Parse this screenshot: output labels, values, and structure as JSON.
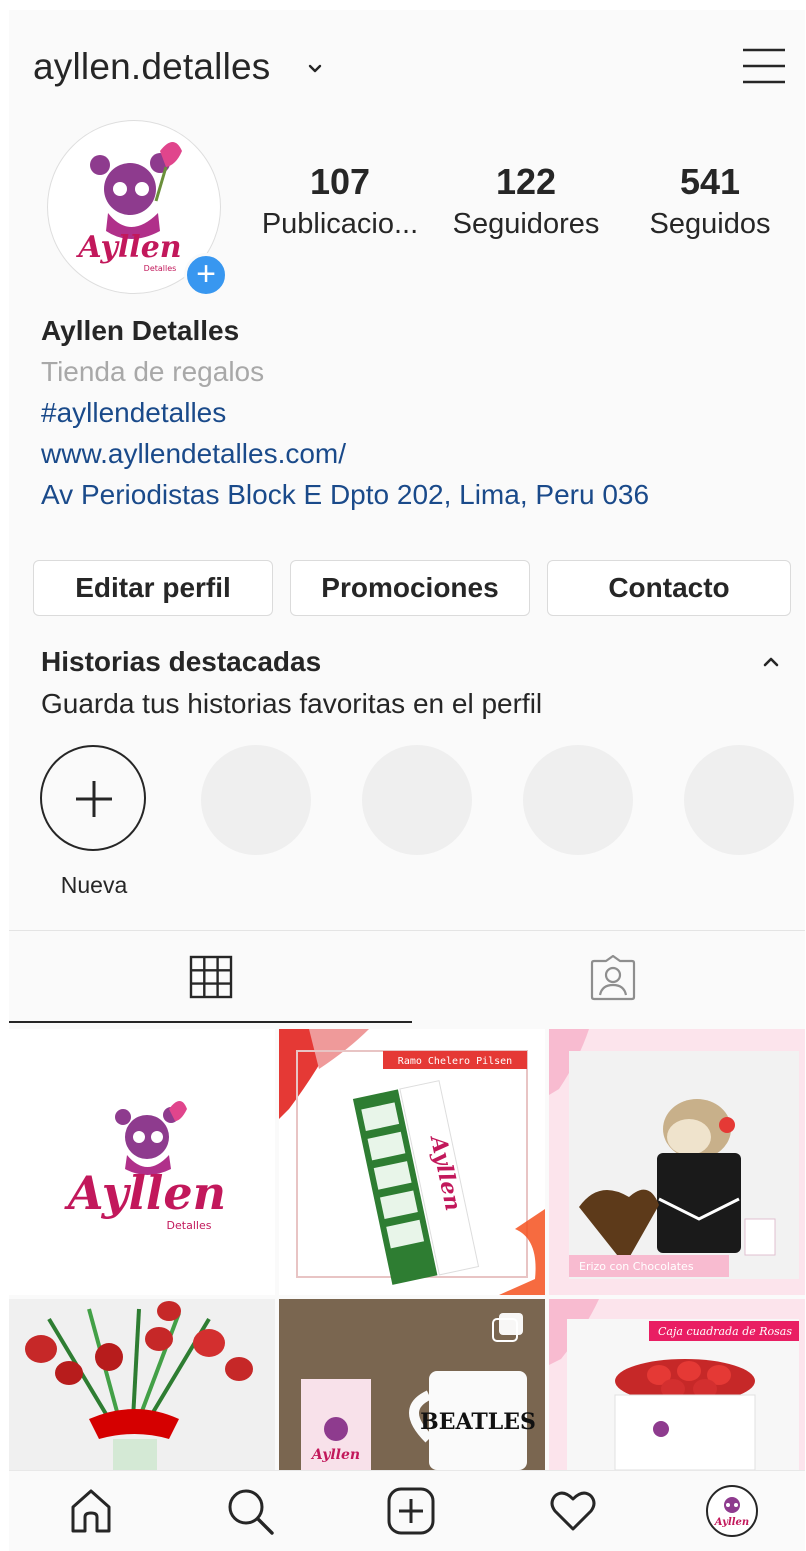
{
  "header": {
    "username": "ayllen.detalles"
  },
  "profile": {
    "avatar_brand": "Ayllen",
    "avatar_sub": "Detalles",
    "stats": [
      {
        "value": "107",
        "label": "Publicacio..."
      },
      {
        "value": "122",
        "label": "Seguidores"
      },
      {
        "value": "541",
        "label": "Seguidos"
      }
    ],
    "name": "Ayllen Detalles",
    "category": "Tienda de regalos",
    "hashtag": "#ayllendetalles",
    "website": "www.ayllendetalles.com/",
    "address": "Av Periodistas Block E Dpto 202, Lima, Peru 036"
  },
  "actions": {
    "edit_label": "Editar perfil",
    "promotions_label": "Promociones",
    "contact_label": "Contacto"
  },
  "highlights": {
    "title": "Historias destacadas",
    "subtitle": "Guarda tus historias favoritas en el perfil",
    "new_label": "Nueva"
  },
  "posts": [
    {
      "brand": "Ayllen",
      "sub": "Detalles"
    },
    {
      "caption": "Ramo Chelero Pilsen",
      "brand": "Ayllen"
    },
    {
      "caption": "Erizo con Chocolates"
    },
    {},
    {
      "mug_text": "BEATLES",
      "brand": "Ayllen"
    },
    {
      "caption": "Caja cuadrada de Rosas"
    }
  ],
  "nav": {
    "avatar_brand": "Ayllen"
  },
  "colors": {
    "accent_blue": "#3897f0",
    "link_blue": "#1a4a8a",
    "brand_pink": "#c2185b"
  }
}
